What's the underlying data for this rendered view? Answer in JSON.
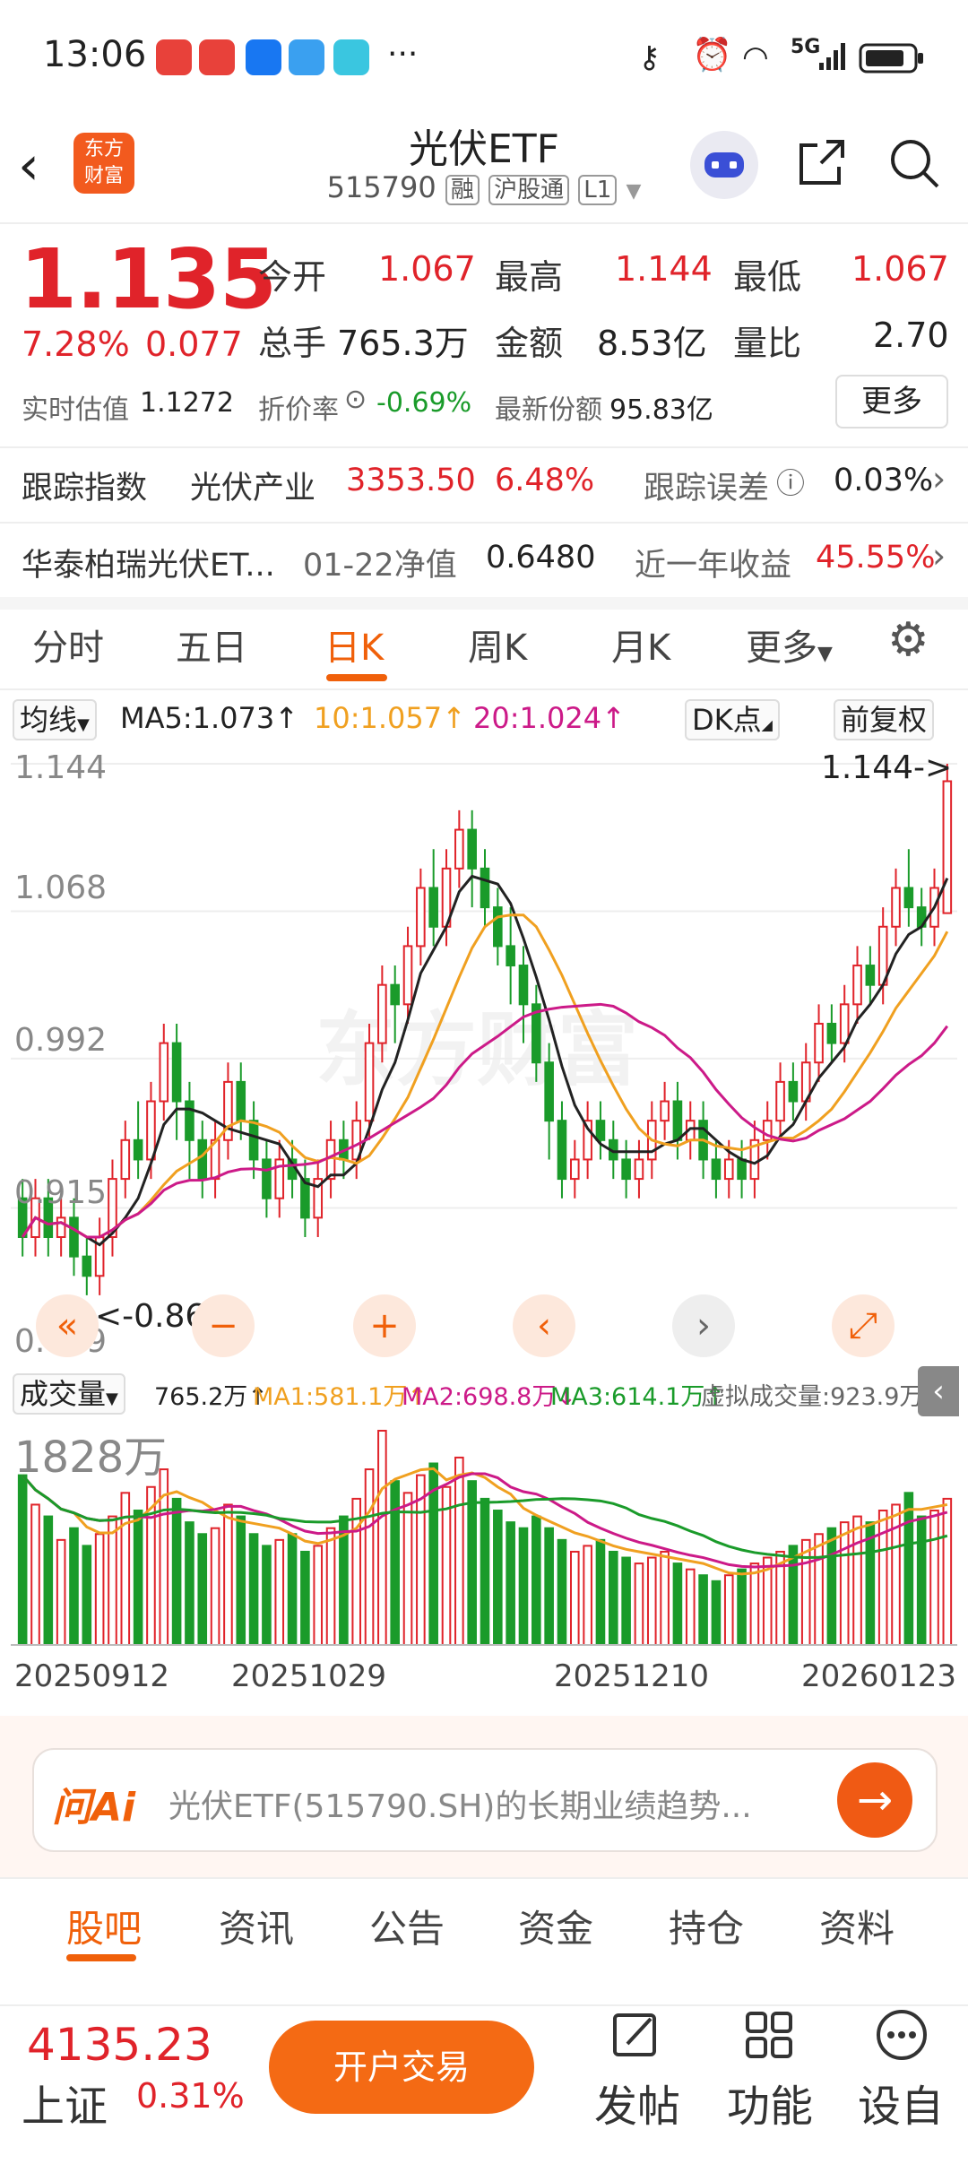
{
  "status": {
    "time": "13:06",
    "more_dots": "···",
    "network": "5G"
  },
  "header": {
    "logo_line1": "东方",
    "logo_line2": "财富",
    "title": "光伏ETF",
    "code": "515790",
    "tag1": "融",
    "tag2": "沪股通",
    "tag3": "L1"
  },
  "quote": {
    "price": "1.135",
    "change_pct": "7.28%",
    "change_abs": "0.077",
    "open_label": "今开",
    "open": "1.067",
    "high_label": "最高",
    "high": "1.144",
    "low_label": "最低",
    "low": "1.067",
    "vol_label": "总手",
    "vol": "765.3万",
    "amount_label": "金额",
    "amount": "8.53亿",
    "ratio_label": "量比",
    "ratio": "2.70",
    "est_label": "实时估值",
    "est": "1.1272",
    "premium_label": "折价率",
    "premium": "-0.69%",
    "share_label": "最新份额",
    "share": "95.83亿",
    "more": "更多"
  },
  "tracking": {
    "label": "跟踪指数",
    "index_name": "光伏产业",
    "index_value": "3353.50",
    "index_pct": "6.48%",
    "error_label": "跟踪误差",
    "error": "0.03%"
  },
  "fund": {
    "name": "华泰柏瑞光伏ET...",
    "nav_label": "01-22净值",
    "nav": "0.6480",
    "return_label": "近一年收益",
    "return": "45.55%"
  },
  "ktabs": [
    "分时",
    "五日",
    "日K",
    "周K",
    "月K",
    "更多"
  ],
  "ma_row": {
    "select": "均线",
    "ma5": "MA5:1.073↑",
    "ma10": "10:1.057↑",
    "ma20": "20:1.024↑",
    "dk": "DK点",
    "fq": "前复权"
  },
  "chart_labels": {
    "y_ticks": [
      "1.144",
      "1.068",
      "0.992",
      "0.915",
      "0.839"
    ],
    "max_note": "1.144->",
    "min_note": "<-0.864",
    "vol_select": "成交量",
    "vol_now": "765.2万↑",
    "vol_ma1": "MA1:581.1万↑",
    "vol_ma2": "MA2:698.8万↓",
    "vol_ma3": "MA3:614.1万↑",
    "vol_virtual": "虚拟成交量:923.9万",
    "vol_max": "1828万",
    "dates": [
      "20250912",
      "20251029",
      "20251210",
      "20260123"
    ],
    "watermark": "东方财富"
  },
  "colors": {
    "up": "#e0232a",
    "down": "#1a9b2a",
    "ma5": "#222222",
    "ma10": "#f0a020",
    "ma20": "#cc1a88",
    "accent": "#f0600a"
  },
  "ai_bar": {
    "logo": "问Ai",
    "prompt": "光伏ETF(515790.SH)的长期业绩趋势..."
  },
  "bottom_tabs": [
    "股吧",
    "资讯",
    "公告",
    "资金",
    "持仓",
    "资料"
  ],
  "footer": {
    "index_value": "4135.23",
    "index_name": "上证",
    "index_pct": "0.31%",
    "open_btn": "开户交易",
    "post": "发帖",
    "func": "功能",
    "custom": "设自"
  },
  "chart_data": {
    "type": "candlestick",
    "ylim": [
      0.839,
      1.144
    ],
    "candles": [
      [
        0.92,
        0.9,
        0.93,
        0.89
      ],
      [
        0.9,
        0.92,
        0.93,
        0.89
      ],
      [
        0.92,
        0.9,
        0.93,
        0.89
      ],
      [
        0.9,
        0.91,
        0.92,
        0.89
      ],
      [
        0.91,
        0.89,
        0.92,
        0.88
      ],
      [
        0.89,
        0.88,
        0.9,
        0.87
      ],
      [
        0.88,
        0.9,
        0.91,
        0.87
      ],
      [
        0.9,
        0.93,
        0.94,
        0.89
      ],
      [
        0.93,
        0.95,
        0.96,
        0.92
      ],
      [
        0.95,
        0.94,
        0.97,
        0.93
      ],
      [
        0.94,
        0.97,
        0.98,
        0.93
      ],
      [
        0.97,
        1.0,
        1.01,
        0.96
      ],
      [
        1.0,
        0.97,
        1.01,
        0.95
      ],
      [
        0.97,
        0.95,
        0.98,
        0.93
      ],
      [
        0.95,
        0.93,
        0.96,
        0.92
      ],
      [
        0.93,
        0.95,
        0.96,
        0.92
      ],
      [
        0.95,
        0.98,
        0.99,
        0.94
      ],
      [
        0.98,
        0.96,
        0.99,
        0.95
      ],
      [
        0.96,
        0.94,
        0.97,
        0.93
      ],
      [
        0.94,
        0.92,
        0.95,
        0.91
      ],
      [
        0.92,
        0.94,
        0.95,
        0.91
      ],
      [
        0.94,
        0.93,
        0.95,
        0.92
      ],
      [
        0.93,
        0.91,
        0.94,
        0.9
      ],
      [
        0.91,
        0.93,
        0.94,
        0.9
      ],
      [
        0.93,
        0.95,
        0.96,
        0.92
      ],
      [
        0.95,
        0.94,
        0.96,
        0.93
      ],
      [
        0.94,
        0.96,
        0.97,
        0.93
      ],
      [
        0.96,
        1.0,
        1.01,
        0.95
      ],
      [
        1.0,
        1.03,
        1.04,
        0.99
      ],
      [
        1.03,
        1.02,
        1.04,
        1.0
      ],
      [
        1.02,
        1.05,
        1.06,
        1.01
      ],
      [
        1.05,
        1.08,
        1.09,
        1.04
      ],
      [
        1.08,
        1.06,
        1.1,
        1.05
      ],
      [
        1.06,
        1.09,
        1.1,
        1.05
      ],
      [
        1.09,
        1.11,
        1.12,
        1.08
      ],
      [
        1.11,
        1.09,
        1.12,
        1.07
      ],
      [
        1.09,
        1.07,
        1.1,
        1.06
      ],
      [
        1.07,
        1.05,
        1.08,
        1.04
      ],
      [
        1.05,
        1.04,
        1.07,
        1.02
      ],
      [
        1.04,
        1.02,
        1.05,
        1.0
      ],
      [
        1.02,
        0.99,
        1.03,
        0.98
      ],
      [
        0.99,
        0.96,
        1.0,
        0.94
      ],
      [
        0.96,
        0.93,
        0.97,
        0.92
      ],
      [
        0.93,
        0.94,
        0.95,
        0.92
      ],
      [
        0.94,
        0.96,
        0.97,
        0.93
      ],
      [
        0.96,
        0.95,
        0.97,
        0.94
      ],
      [
        0.95,
        0.94,
        0.96,
        0.93
      ],
      [
        0.94,
        0.93,
        0.95,
        0.92
      ],
      [
        0.93,
        0.94,
        0.95,
        0.92
      ],
      [
        0.94,
        0.96,
        0.97,
        0.93
      ],
      [
        0.96,
        0.97,
        0.98,
        0.95
      ],
      [
        0.97,
        0.95,
        0.98,
        0.94
      ],
      [
        0.95,
        0.96,
        0.97,
        0.94
      ],
      [
        0.96,
        0.94,
        0.97,
        0.93
      ],
      [
        0.94,
        0.93,
        0.95,
        0.92
      ],
      [
        0.93,
        0.94,
        0.95,
        0.92
      ],
      [
        0.94,
        0.93,
        0.95,
        0.92
      ],
      [
        0.93,
        0.95,
        0.96,
        0.92
      ],
      [
        0.95,
        0.96,
        0.97,
        0.94
      ],
      [
        0.96,
        0.98,
        0.99,
        0.95
      ],
      [
        0.98,
        0.97,
        0.99,
        0.96
      ],
      [
        0.97,
        0.99,
        1.0,
        0.96
      ],
      [
        0.99,
        1.01,
        1.02,
        0.98
      ],
      [
        1.01,
        1.0,
        1.02,
        0.99
      ],
      [
        1.0,
        1.02,
        1.03,
        0.99
      ],
      [
        1.02,
        1.04,
        1.05,
        1.01
      ],
      [
        1.04,
        1.03,
        1.05,
        1.02
      ],
      [
        1.03,
        1.06,
        1.07,
        1.02
      ],
      [
        1.06,
        1.08,
        1.09,
        1.05
      ],
      [
        1.08,
        1.07,
        1.1,
        1.06
      ],
      [
        1.07,
        1.06,
        1.08,
        1.05
      ],
      [
        1.06,
        1.08,
        1.09,
        1.05
      ],
      [
        1.067,
        1.135,
        1.144,
        1.067
      ]
    ],
    "volumes": [
      1450,
      1200,
      1100,
      900,
      1000,
      850,
      950,
      1100,
      1300,
      1150,
      1350,
      1500,
      1250,
      1050,
      950,
      1000,
      1200,
      1100,
      950,
      850,
      900,
      950,
      800,
      850,
      1000,
      1100,
      1250,
      1500,
      1828,
      1400,
      1300,
      1450,
      1550,
      1350,
      1600,
      1400,
      1250,
      1150,
      1050,
      1000,
      1100,
      1000,
      900,
      800,
      850,
      900,
      800,
      750,
      700,
      750,
      800,
      700,
      650,
      600,
      550,
      600,
      650,
      700,
      750,
      800,
      850,
      900,
      950,
      1000,
      1050,
      1100,
      1050,
      1150,
      1200,
      1300,
      1100,
      1150,
      1250
    ]
  }
}
